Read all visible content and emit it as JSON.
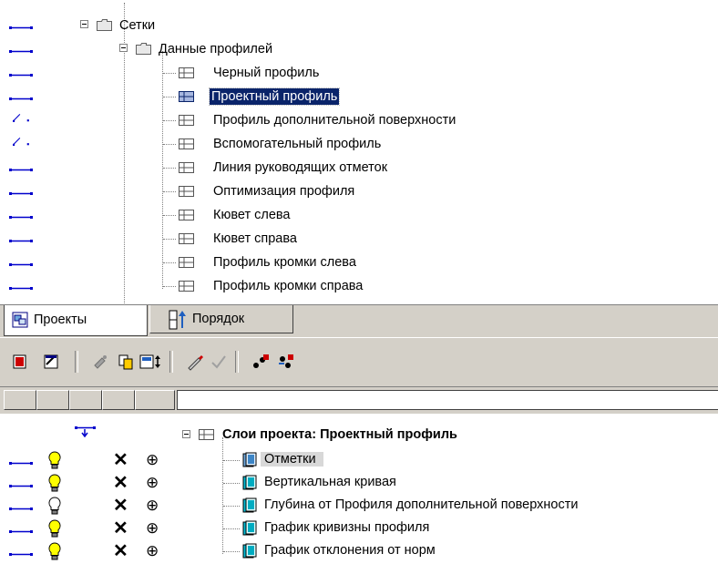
{
  "top_tree": {
    "root": {
      "label": "Сетки"
    },
    "folder": {
      "label": "Данные профилей"
    },
    "items": [
      {
        "label": "Черный профиль",
        "line": "solid"
      },
      {
        "label": "Проектный профиль",
        "line": "solid",
        "selected": true
      },
      {
        "label": "Профиль дополнительной поверхности",
        "line": "slant"
      },
      {
        "label": "Вспомогательный профиль",
        "line": "slant"
      },
      {
        "label": "Линия руководящих отметок",
        "line": "solid"
      },
      {
        "label": "Оптимизация профиля",
        "line": "solid"
      },
      {
        "label": "Кювет слева",
        "line": "solid"
      },
      {
        "label": "Кювет справа",
        "line": "solid"
      },
      {
        "label": "Профиль кромки слева",
        "line": "solid"
      },
      {
        "label": "Профиль кромки справа",
        "line": "solid"
      }
    ]
  },
  "tabs": [
    {
      "label": "Проекты",
      "icon": "projects-icon",
      "active": true
    },
    {
      "label": "Порядок",
      "icon": "order-icon",
      "active": false
    }
  ],
  "toolbar": {
    "buttons": [
      "new-layer-icon",
      "properties-icon",
      "brush-icon",
      "copy-icon",
      "sort-icon",
      "pencil-icon",
      "check-icon",
      "add-node-icon",
      "move-node-icon"
    ]
  },
  "filter": {
    "value": ""
  },
  "bottom_tree": {
    "header": "Слои проекта: Проектный профиль",
    "layers": [
      {
        "label": "Отметки",
        "highlighted": true,
        "bulb_on": true
      },
      {
        "label": "Вертикальная кривая",
        "highlighted": false,
        "bulb_on": true
      },
      {
        "label": "Глубина от Профиля дополнительной поверхности",
        "highlighted": false,
        "bulb_on": false
      },
      {
        "label": "График кривизны профиля",
        "highlighted": false,
        "bulb_on": true
      },
      {
        "label": "График отклонения от норм",
        "highlighted": false,
        "bulb_on": true
      }
    ]
  },
  "colors": {
    "selection": "#0a246a",
    "line_style": "#0000cc",
    "chrome": "#d4d0c8"
  }
}
